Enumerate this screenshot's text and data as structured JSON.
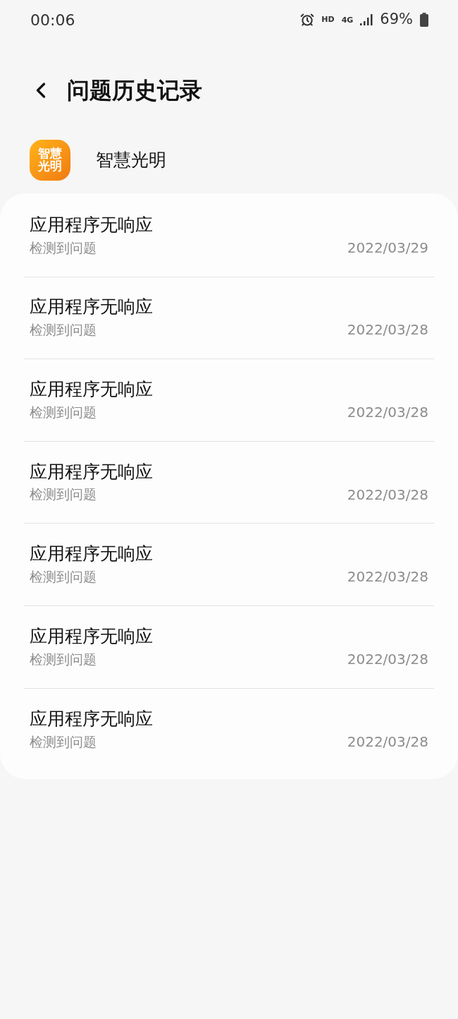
{
  "status_bar": {
    "time": "00:06",
    "network_label": "HD",
    "network_type": "4G",
    "battery": "69%"
  },
  "header": {
    "title": "问题历史记录"
  },
  "app": {
    "name": "智慧光明",
    "icon_text": [
      "智慧",
      "光明"
    ]
  },
  "records": [
    {
      "title": "应用程序无响应",
      "subtitle": "检测到问题",
      "date": "2022/03/29"
    },
    {
      "title": "应用程序无响应",
      "subtitle": "检测到问题",
      "date": "2022/03/28"
    },
    {
      "title": "应用程序无响应",
      "subtitle": "检测到问题",
      "date": "2022/03/28"
    },
    {
      "title": "应用程序无响应",
      "subtitle": "检测到问题",
      "date": "2022/03/28"
    },
    {
      "title": "应用程序无响应",
      "subtitle": "检测到问题",
      "date": "2022/03/28"
    },
    {
      "title": "应用程序无响应",
      "subtitle": "检测到问题",
      "date": "2022/03/28"
    },
    {
      "title": "应用程序无响应",
      "subtitle": "检测到问题",
      "date": "2022/03/28"
    }
  ]
}
